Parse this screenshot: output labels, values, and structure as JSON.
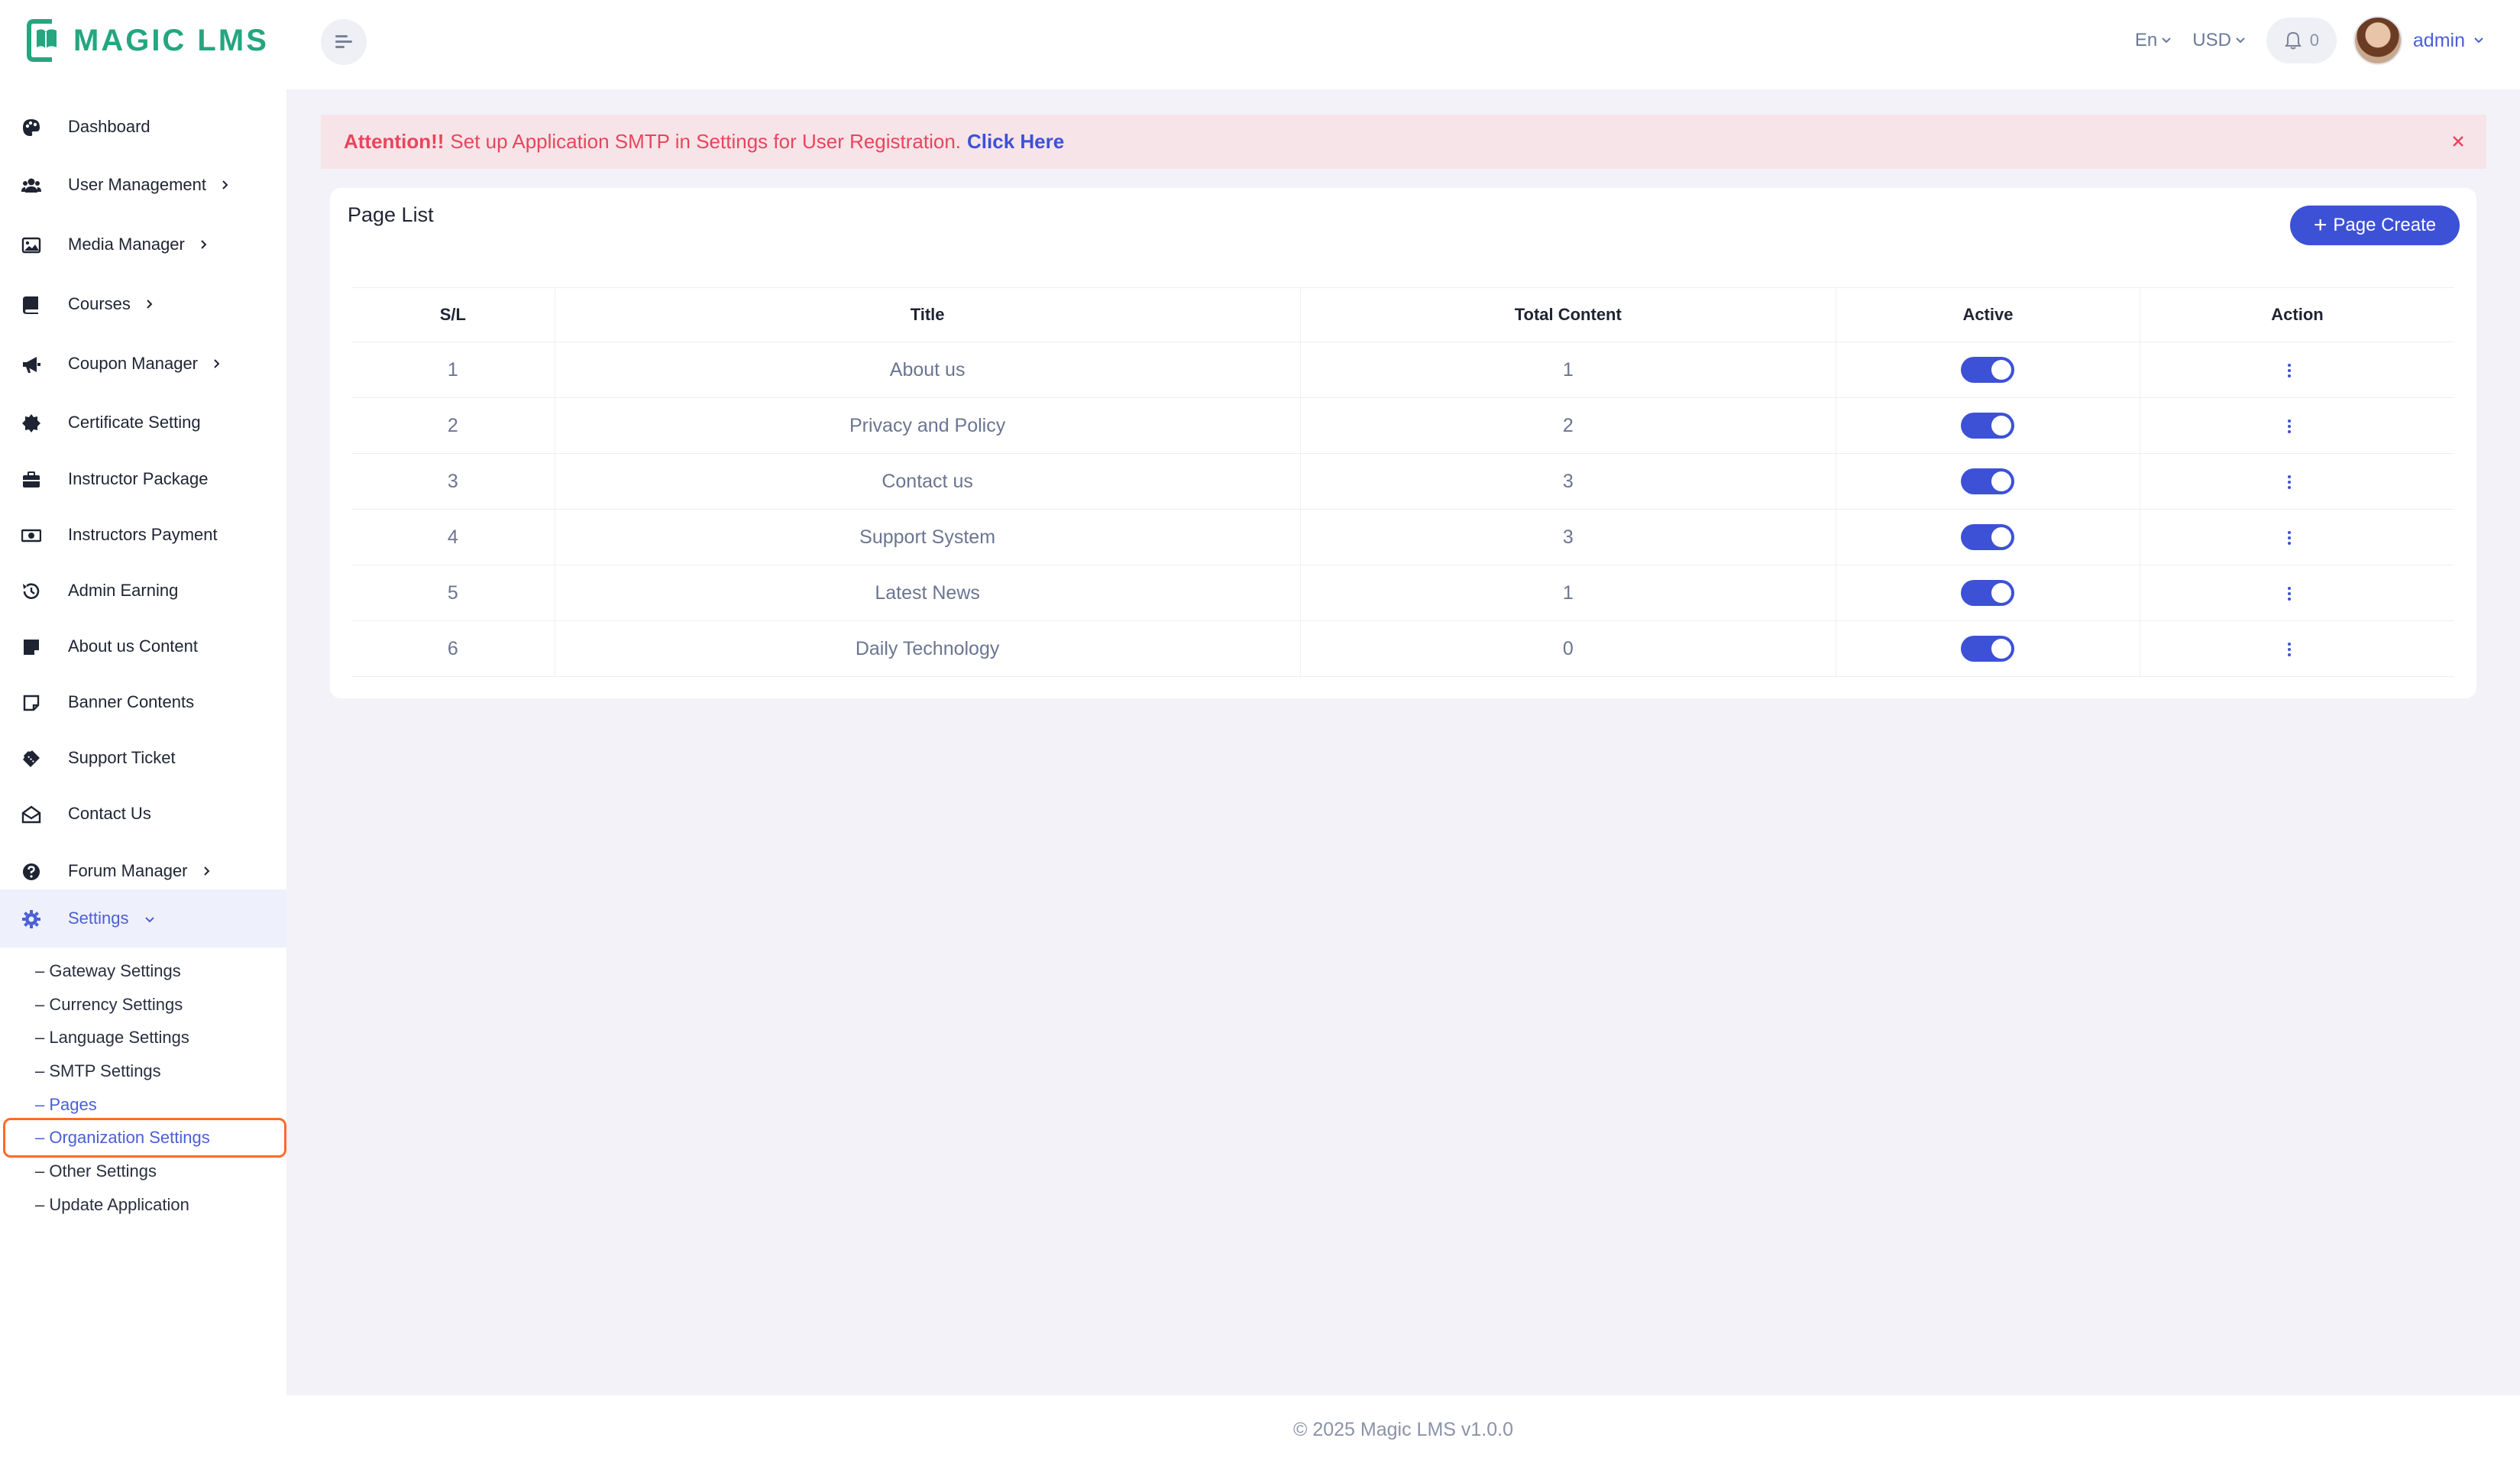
{
  "app": {
    "name": "MAGIC LMS",
    "brand_color": "#24a67f",
    "accent_color": "#3d51d6"
  },
  "header": {
    "language": "En",
    "currency": "USD",
    "notification_count": "0",
    "user": "admin",
    "icons": [
      "menu-toggle-icon",
      "chevron-down-icon",
      "bell-icon",
      "avatar"
    ]
  },
  "sidebar": {
    "items": [
      {
        "label": "Dashboard",
        "icon": "palette-icon"
      },
      {
        "label": "User Management",
        "icon": "users-icon",
        "has_children": true
      },
      {
        "label": "Media Manager",
        "icon": "image-icon",
        "has_children": true
      },
      {
        "label": "Courses",
        "icon": "book-icon",
        "has_children": true
      },
      {
        "label": "Coupon Manager",
        "icon": "megaphone-icon",
        "has_children": true
      },
      {
        "label": "Certificate Setting",
        "icon": "certificate-icon"
      },
      {
        "label": "Instructor Package",
        "icon": "briefcase-icon"
      },
      {
        "label": "Instructors Payment",
        "icon": "money-icon"
      },
      {
        "label": "Admin Earning",
        "icon": "history-icon"
      },
      {
        "label": "About us Content",
        "icon": "note-icon"
      },
      {
        "label": "Banner Contents",
        "icon": "sticky-note-icon"
      },
      {
        "label": "Support Ticket",
        "icon": "ticket-icon"
      },
      {
        "label": "Contact Us",
        "icon": "envelope-open-icon"
      },
      {
        "label": "Forum Manager",
        "icon": "question-icon",
        "has_children": true
      },
      {
        "label": "Settings",
        "icon": "gear-icon",
        "expanded": true
      }
    ],
    "settings_children": [
      "– Gateway Settings",
      "– Currency Settings",
      "– Language Settings",
      "– SMTP Settings",
      "– Pages",
      "– Organization Settings",
      "– Other Settings",
      "– Update Application"
    ],
    "current_child": "– Pages",
    "highlighted_child": "– Organization Settings"
  },
  "alert": {
    "strong": "Attention!!",
    "text": "Set up Application SMTP in Settings for User Registration.",
    "link": "Click Here"
  },
  "page_list": {
    "title": "Page List",
    "create_button": "Page Create",
    "columns": [
      "S/L",
      "Title",
      "Total Content",
      "Active",
      "Action"
    ],
    "rows": [
      {
        "sl": "1",
        "title": "About us",
        "total": "1",
        "active": true
      },
      {
        "sl": "2",
        "title": "Privacy and Policy",
        "total": "2",
        "active": true
      },
      {
        "sl": "3",
        "title": "Contact us",
        "total": "3",
        "active": true
      },
      {
        "sl": "4",
        "title": "Support System",
        "total": "3",
        "active": true
      },
      {
        "sl": "5",
        "title": "Latest News",
        "total": "1",
        "active": true
      },
      {
        "sl": "6",
        "title": "Daily Technology",
        "total": "0",
        "active": true
      }
    ]
  },
  "footer": {
    "text": "© 2025 Magic LMS v1.0.0"
  }
}
